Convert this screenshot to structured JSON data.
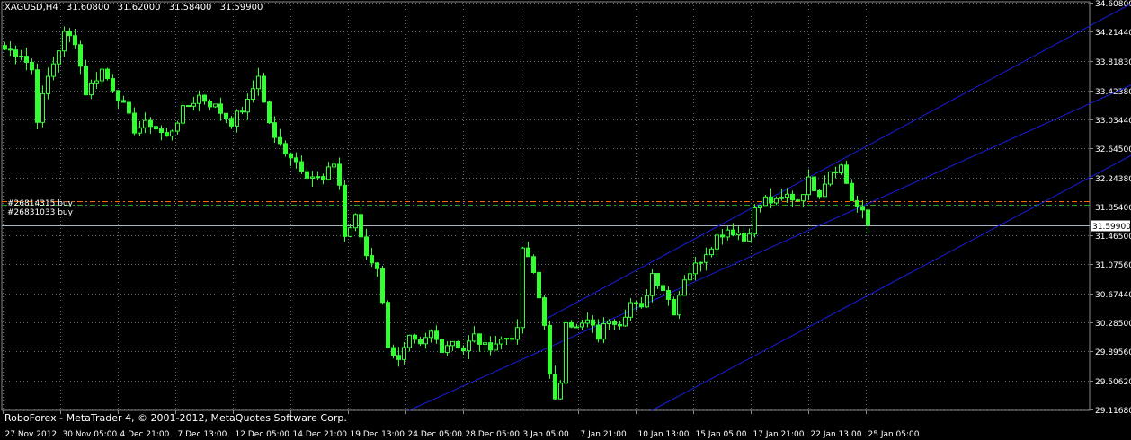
{
  "header": {
    "symbol_tf": "XAGUSD,H4",
    "open": "31.60800",
    "high": "31.62000",
    "low": "31.58400",
    "close": "31.59900"
  },
  "copyright": "RoboForex - MetaTrader 4, © 2001-2012, MetaQuotes Software Corp.",
  "orders": [
    {
      "label": "#26814315 buy",
      "price": 31.93,
      "color": "#ff6a00"
    },
    {
      "label": "#26831033 buy",
      "price": 31.88,
      "color": "#2e9c2e"
    }
  ],
  "colors": {
    "background": "#000000",
    "grid": "#5a6a74",
    "candle": "#33ff33",
    "channel": "#1b1bdc",
    "axis_text": "#ffffff",
    "price_line": "#a9b6c2"
  },
  "chart_data": {
    "type": "candlestick",
    "symbol": "XAGUSD",
    "timeframe": "H4",
    "y_ticks": [
      34.608,
      34.2144,
      33.8208,
      33.4238,
      33.0344,
      32.645,
      32.2438,
      31.854,
      31.465,
      31.0756,
      30.6744,
      30.285,
      29.8956,
      29.5062,
      29.1168
    ],
    "y_tick_labels": [
      "34.60800",
      "34.21440",
      "33.81830",
      "33.42380",
      "33.03440",
      "32.64500",
      "32.24380",
      "31.85400",
      "31.46500",
      "31.07560",
      "30.67440",
      "30.28500",
      "29.89560",
      "29.50620",
      "29.11680"
    ],
    "ylim": [
      29.1,
      34.62
    ],
    "x_labels": [
      "27 Nov 2012",
      "30 Nov 05:00",
      "4 Dec 21:00",
      "7 Dec 13:00",
      "12 Dec 05:00",
      "14 Dec 21:00",
      "19 Dec 13:00",
      "24 Dec 05:00",
      "28 Dec 05:00",
      "3 Jan 05:00",
      "7 Jan 21:00",
      "10 Jan 13:00",
      "15 Jan 05:00",
      "17 Jan 21:00",
      "22 Jan 13:00",
      "25 Jan 05:00"
    ],
    "current_price": 31.599,
    "current_price_label": "31.59900",
    "anchors": [
      [
        0,
        33.98
      ],
      [
        3,
        33.92
      ],
      [
        5,
        33.7
      ],
      [
        6,
        33.05
      ],
      [
        8,
        33.6
      ],
      [
        11,
        34.18
      ],
      [
        13,
        34.1
      ],
      [
        15,
        33.4
      ],
      [
        18,
        33.7
      ],
      [
        21,
        33.35
      ],
      [
        24,
        32.9
      ],
      [
        27,
        32.98
      ],
      [
        30,
        32.78
      ],
      [
        33,
        33.15
      ],
      [
        36,
        33.35
      ],
      [
        39,
        33.2
      ],
      [
        42,
        33.0
      ],
      [
        45,
        33.25
      ],
      [
        47,
        33.65
      ],
      [
        48,
        33.25
      ],
      [
        50,
        32.75
      ],
      [
        53,
        32.55
      ],
      [
        56,
        32.3
      ],
      [
        59,
        32.2
      ],
      [
        61,
        32.45
      ],
      [
        62,
        32.15
      ],
      [
        63,
        31.45
      ],
      [
        65,
        31.7
      ],
      [
        67,
        31.2
      ],
      [
        69,
        31.05
      ],
      [
        71,
        30.0
      ],
      [
        73,
        29.75
      ],
      [
        75,
        30.05
      ],
      [
        77,
        29.95
      ],
      [
        79,
        30.15
      ],
      [
        81,
        29.95
      ],
      [
        83,
        30.05
      ],
      [
        85,
        29.92
      ],
      [
        87,
        30.1
      ],
      [
        89,
        29.95
      ],
      [
        92,
        30.05
      ],
      [
        95,
        30.15
      ],
      [
        96,
        31.3
      ],
      [
        98,
        30.95
      ],
      [
        100,
        30.3
      ],
      [
        101,
        29.55
      ],
      [
        102,
        29.2
      ],
      [
        103,
        29.5
      ],
      [
        104,
        30.35
      ],
      [
        106,
        30.2
      ],
      [
        108,
        30.3
      ],
      [
        110,
        30.1
      ],
      [
        112,
        30.35
      ],
      [
        114,
        30.3
      ],
      [
        116,
        30.55
      ],
      [
        118,
        30.45
      ],
      [
        120,
        30.95
      ],
      [
        122,
        30.75
      ],
      [
        124,
        30.45
      ],
      [
        126,
        30.9
      ],
      [
        128,
        31.05
      ],
      [
        130,
        31.25
      ],
      [
        132,
        31.45
      ],
      [
        134,
        31.55
      ],
      [
        136,
        31.5
      ],
      [
        137,
        31.4
      ],
      [
        138,
        31.55
      ],
      [
        139,
        31.8
      ],
      [
        141,
        31.95
      ],
      [
        143,
        31.9
      ],
      [
        145,
        32.0
      ],
      [
        147,
        31.95
      ],
      [
        149,
        32.2
      ],
      [
        151,
        32.05
      ],
      [
        153,
        32.35
      ],
      [
        155,
        32.4
      ],
      [
        157,
        31.95
      ],
      [
        159,
        31.75
      ],
      [
        160,
        31.6
      ]
    ],
    "channel_lines": [
      {
        "x0": 100,
        "y0": 30.32,
        "x1": 209,
        "y1": 34.6
      },
      {
        "x0": 75,
        "y0": 29.1,
        "x1": 209,
        "y1": 33.5
      },
      {
        "x0": 120,
        "y0": 29.1,
        "x1": 209,
        "y1": 32.55
      }
    ]
  }
}
